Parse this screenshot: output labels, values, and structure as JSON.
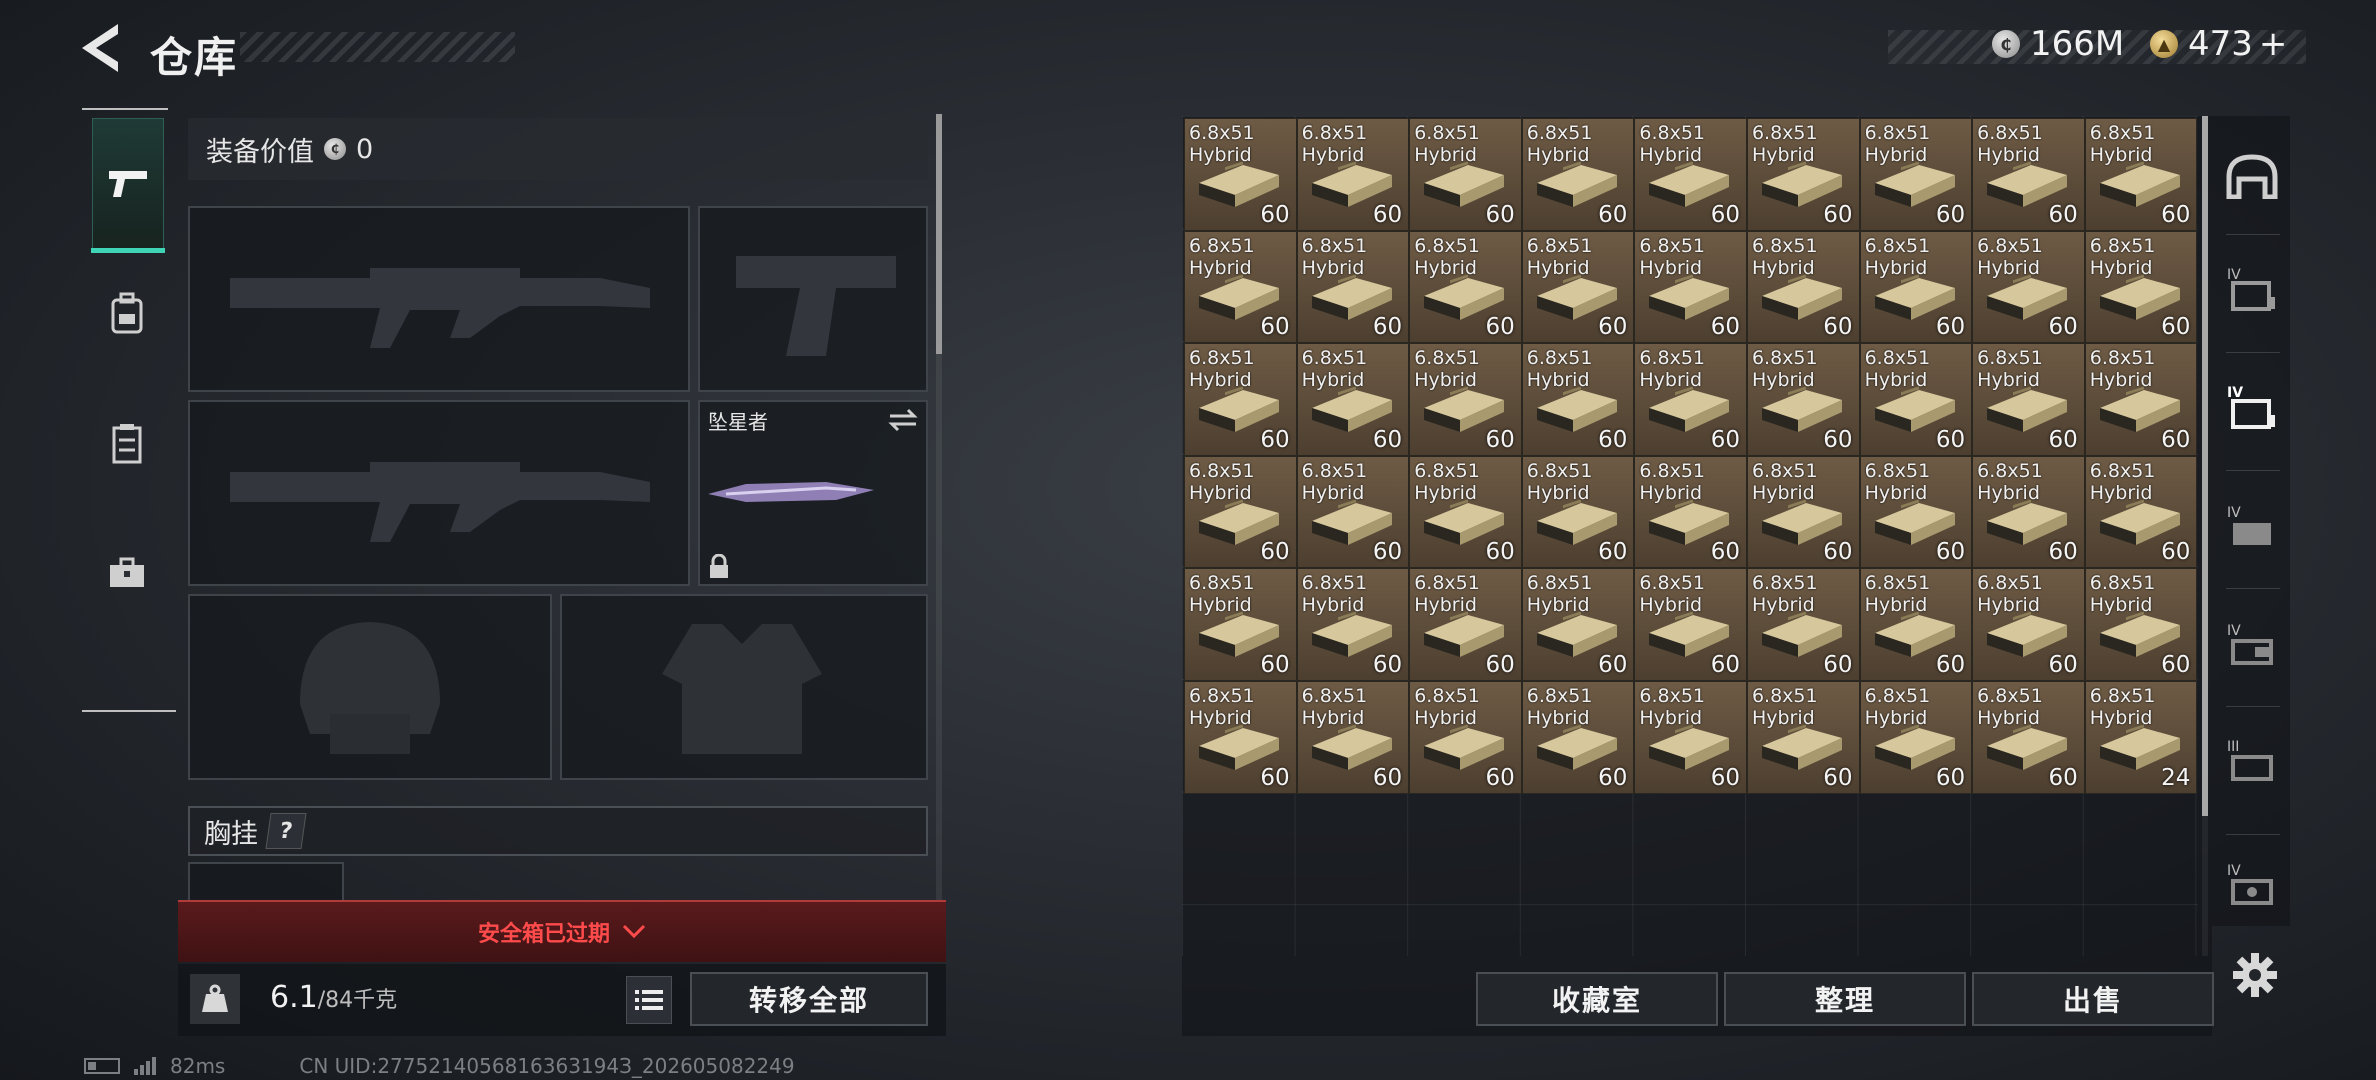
{
  "header": {
    "title": "仓库"
  },
  "currency": {
    "silver": "166M",
    "gold": "473",
    "gold_plus": "+"
  },
  "rail": {
    "items": [
      "pistol-icon",
      "backpack-icon",
      "vest-icon",
      "toolbox-icon"
    ],
    "active_index": 0
  },
  "equipment": {
    "value_label": "装备价值",
    "value": "0",
    "melee_name": "坠星者",
    "chest_rig_label": "胸挂",
    "chest_help": "?",
    "expired_text": "安全箱已过期",
    "weight_current": "6.1",
    "weight_max": "/84千克",
    "transfer_all": "转移全部"
  },
  "inventory": {
    "item_name_line1": "6.8x51",
    "item_name_line2": "Hybrid",
    "quantities": [
      "60",
      "60",
      "60",
      "60",
      "60",
      "60",
      "60",
      "60",
      "60",
      "60",
      "60",
      "60",
      "60",
      "60",
      "60",
      "60",
      "60",
      "60",
      "60",
      "60",
      "60",
      "60",
      "60",
      "60",
      "60",
      "60",
      "60",
      "60",
      "60",
      "60",
      "60",
      "60",
      "60",
      "60",
      "60",
      "60",
      "60",
      "60",
      "60",
      "60",
      "60",
      "60",
      "60",
      "60",
      "60",
      "60",
      "60",
      "60",
      "60",
      "60",
      "60",
      "60",
      "60",
      "24"
    ],
    "buttons": {
      "collection": "收藏室",
      "sort": "整理",
      "sell": "出售"
    }
  },
  "right_rail": {
    "tabs": [
      "helmet-icon",
      "box-iv-icon",
      "box-iv-active-icon",
      "box-iv-case-icon",
      "box-iv-gun-icon",
      "box-iii-icon",
      "box-iv-chip-icon"
    ]
  },
  "status": {
    "ping": "82ms",
    "uid": "CN UID:2775214056816363194З_202605082249"
  },
  "colors": {
    "accent": "#3fd4b6",
    "warning": "#ff4b4b",
    "ammo_box": "#c9b98f"
  }
}
